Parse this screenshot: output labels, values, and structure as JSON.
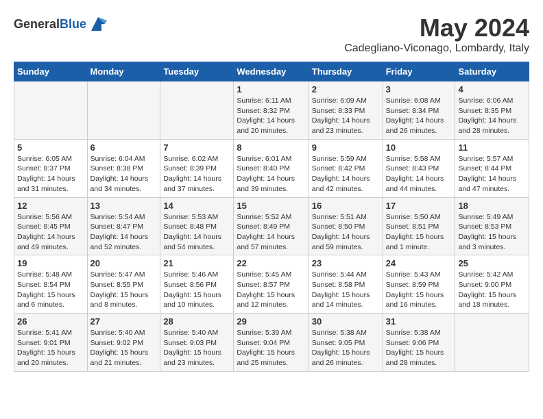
{
  "header": {
    "logo_general": "General",
    "logo_blue": "Blue",
    "month": "May 2024",
    "location": "Cadegliano-Viconago, Lombardy, Italy"
  },
  "weekdays": [
    "Sunday",
    "Monday",
    "Tuesday",
    "Wednesday",
    "Thursday",
    "Friday",
    "Saturday"
  ],
  "weeks": [
    [
      {
        "day": "",
        "info": ""
      },
      {
        "day": "",
        "info": ""
      },
      {
        "day": "",
        "info": ""
      },
      {
        "day": "1",
        "info": "Sunrise: 6:11 AM\nSunset: 8:32 PM\nDaylight: 14 hours\nand 20 minutes."
      },
      {
        "day": "2",
        "info": "Sunrise: 6:09 AM\nSunset: 8:33 PM\nDaylight: 14 hours\nand 23 minutes."
      },
      {
        "day": "3",
        "info": "Sunrise: 6:08 AM\nSunset: 8:34 PM\nDaylight: 14 hours\nand 26 minutes."
      },
      {
        "day": "4",
        "info": "Sunrise: 6:06 AM\nSunset: 8:35 PM\nDaylight: 14 hours\nand 28 minutes."
      }
    ],
    [
      {
        "day": "5",
        "info": "Sunrise: 6:05 AM\nSunset: 8:37 PM\nDaylight: 14 hours\nand 31 minutes."
      },
      {
        "day": "6",
        "info": "Sunrise: 6:04 AM\nSunset: 8:38 PM\nDaylight: 14 hours\nand 34 minutes."
      },
      {
        "day": "7",
        "info": "Sunrise: 6:02 AM\nSunset: 8:39 PM\nDaylight: 14 hours\nand 37 minutes."
      },
      {
        "day": "8",
        "info": "Sunrise: 6:01 AM\nSunset: 8:40 PM\nDaylight: 14 hours\nand 39 minutes."
      },
      {
        "day": "9",
        "info": "Sunrise: 5:59 AM\nSunset: 8:42 PM\nDaylight: 14 hours\nand 42 minutes."
      },
      {
        "day": "10",
        "info": "Sunrise: 5:58 AM\nSunset: 8:43 PM\nDaylight: 14 hours\nand 44 minutes."
      },
      {
        "day": "11",
        "info": "Sunrise: 5:57 AM\nSunset: 8:44 PM\nDaylight: 14 hours\nand 47 minutes."
      }
    ],
    [
      {
        "day": "12",
        "info": "Sunrise: 5:56 AM\nSunset: 8:45 PM\nDaylight: 14 hours\nand 49 minutes."
      },
      {
        "day": "13",
        "info": "Sunrise: 5:54 AM\nSunset: 8:47 PM\nDaylight: 14 hours\nand 52 minutes."
      },
      {
        "day": "14",
        "info": "Sunrise: 5:53 AM\nSunset: 8:48 PM\nDaylight: 14 hours\nand 54 minutes."
      },
      {
        "day": "15",
        "info": "Sunrise: 5:52 AM\nSunset: 8:49 PM\nDaylight: 14 hours\nand 57 minutes."
      },
      {
        "day": "16",
        "info": "Sunrise: 5:51 AM\nSunset: 8:50 PM\nDaylight: 14 hours\nand 59 minutes."
      },
      {
        "day": "17",
        "info": "Sunrise: 5:50 AM\nSunset: 8:51 PM\nDaylight: 15 hours\nand 1 minute."
      },
      {
        "day": "18",
        "info": "Sunrise: 5:49 AM\nSunset: 8:53 PM\nDaylight: 15 hours\nand 3 minutes."
      }
    ],
    [
      {
        "day": "19",
        "info": "Sunrise: 5:48 AM\nSunset: 8:54 PM\nDaylight: 15 hours\nand 6 minutes."
      },
      {
        "day": "20",
        "info": "Sunrise: 5:47 AM\nSunset: 8:55 PM\nDaylight: 15 hours\nand 8 minutes."
      },
      {
        "day": "21",
        "info": "Sunrise: 5:46 AM\nSunset: 8:56 PM\nDaylight: 15 hours\nand 10 minutes."
      },
      {
        "day": "22",
        "info": "Sunrise: 5:45 AM\nSunset: 8:57 PM\nDaylight: 15 hours\nand 12 minutes."
      },
      {
        "day": "23",
        "info": "Sunrise: 5:44 AM\nSunset: 8:58 PM\nDaylight: 15 hours\nand 14 minutes."
      },
      {
        "day": "24",
        "info": "Sunrise: 5:43 AM\nSunset: 8:59 PM\nDaylight: 15 hours\nand 16 minutes."
      },
      {
        "day": "25",
        "info": "Sunrise: 5:42 AM\nSunset: 9:00 PM\nDaylight: 15 hours\nand 18 minutes."
      }
    ],
    [
      {
        "day": "26",
        "info": "Sunrise: 5:41 AM\nSunset: 9:01 PM\nDaylight: 15 hours\nand 20 minutes."
      },
      {
        "day": "27",
        "info": "Sunrise: 5:40 AM\nSunset: 9:02 PM\nDaylight: 15 hours\nand 21 minutes."
      },
      {
        "day": "28",
        "info": "Sunrise: 5:40 AM\nSunset: 9:03 PM\nDaylight: 15 hours\nand 23 minutes."
      },
      {
        "day": "29",
        "info": "Sunrise: 5:39 AM\nSunset: 9:04 PM\nDaylight: 15 hours\nand 25 minutes."
      },
      {
        "day": "30",
        "info": "Sunrise: 5:38 AM\nSunset: 9:05 PM\nDaylight: 15 hours\nand 26 minutes."
      },
      {
        "day": "31",
        "info": "Sunrise: 5:38 AM\nSunset: 9:06 PM\nDaylight: 15 hours\nand 28 minutes."
      },
      {
        "day": "",
        "info": ""
      }
    ]
  ]
}
